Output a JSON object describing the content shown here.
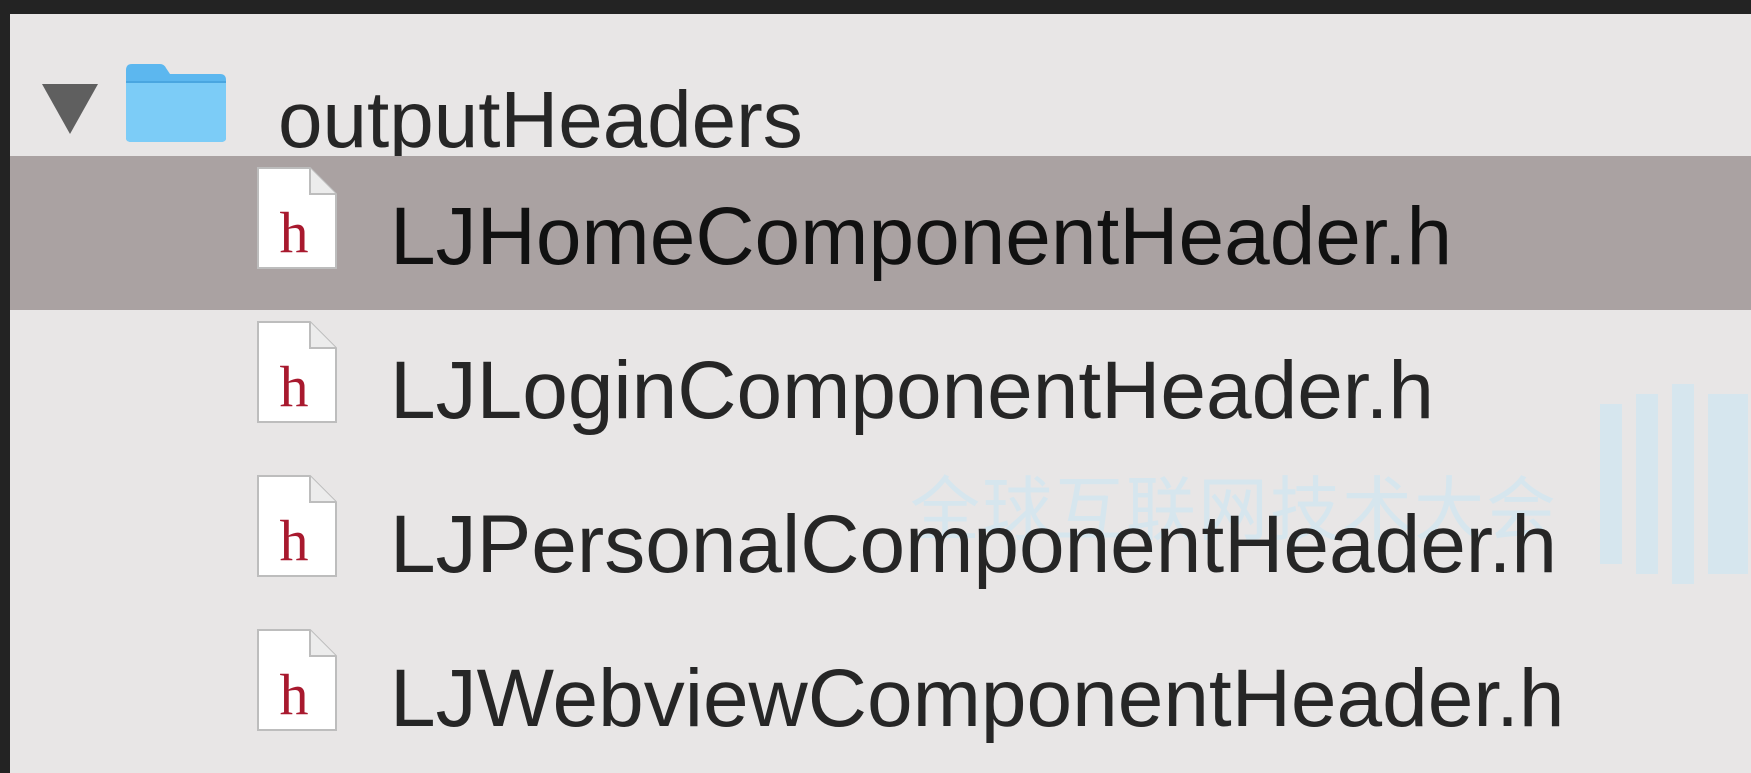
{
  "tree": {
    "folder": {
      "name": "outputHeaders",
      "expanded": true,
      "icon": "folder-icon",
      "color": "#6fc3f4"
    },
    "files": [
      {
        "name": "LJHomeComponentHeader.h",
        "icon": "header-file-icon",
        "glyph": "h",
        "selected": true
      },
      {
        "name": "LJLoginComponentHeader.h",
        "icon": "header-file-icon",
        "glyph": "h",
        "selected": false
      },
      {
        "name": "LJPersonalComponentHeader.h",
        "icon": "header-file-icon",
        "glyph": "h",
        "selected": false
      },
      {
        "name": "LJWebviewComponentHeader.h",
        "icon": "header-file-icon",
        "glyph": "h",
        "selected": false
      }
    ]
  },
  "colors": {
    "window_background": "#232323",
    "panel_background": "#e8e6e6",
    "selection": "#aaa2a2",
    "header_glyph": "#a8192e"
  },
  "watermark": {
    "text": "全球互联网技术大会"
  }
}
